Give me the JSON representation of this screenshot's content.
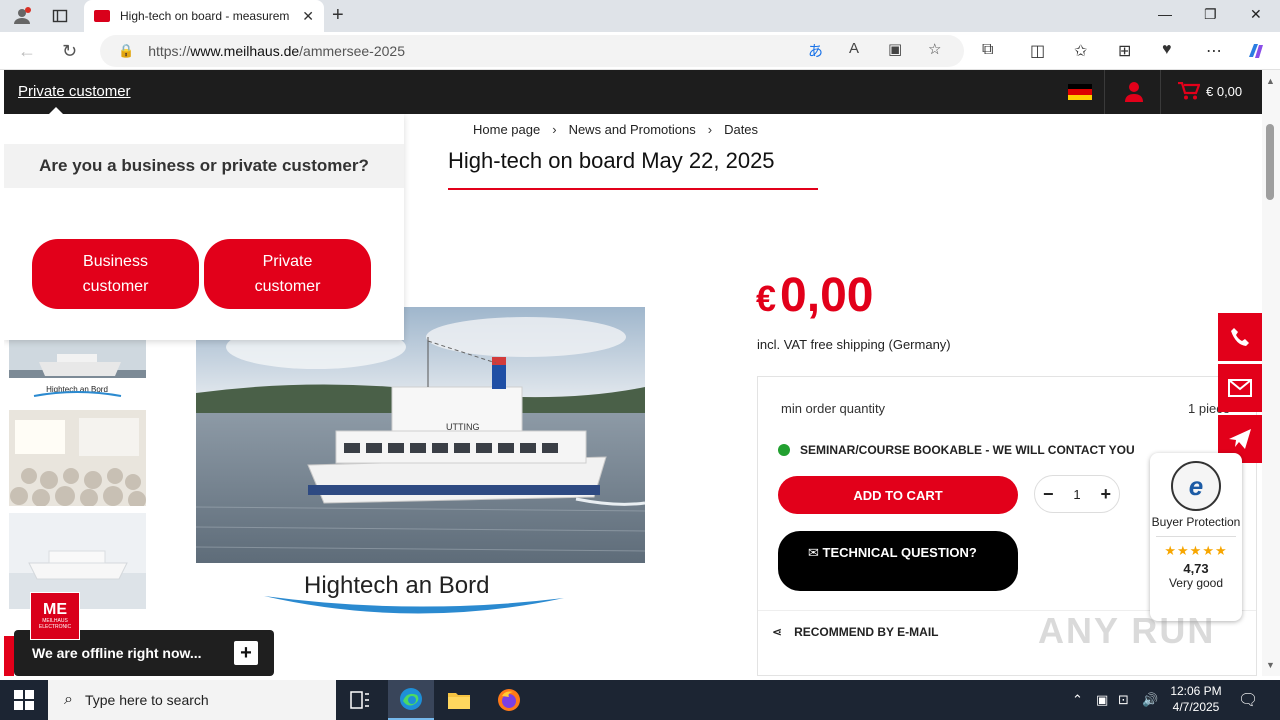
{
  "browser": {
    "tab_title": "High-tech on board - measurem",
    "url_scheme": "https://",
    "url_host": "www.meilhaus.de",
    "url_path": "/ammersee-2025"
  },
  "header": {
    "customer_link": "Private customer",
    "cart_total": "€ 0,00"
  },
  "popup": {
    "question": "Are you a business or private customer?",
    "business_button": "Business customer",
    "private_button": "Private customer"
  },
  "breadcrumb": [
    "Home page",
    "News and Promotions",
    "Dates"
  ],
  "product": {
    "title": "High-tech on board May 22, 2025",
    "price_currency": "€",
    "price_value": "0,00",
    "vat_note": "incl. VAT free shipping (Germany)",
    "image_caption": "Hightech an Bord",
    "thumb_caption": "Hightech an Bord",
    "ship_name": "UTTING",
    "min_order_label": "min order quantity",
    "min_order_value": "1 piece",
    "status": "SEMINAR/COURSE BOOKABLE - WE WILL CONTACT YOU",
    "add_to_cart": "ADD TO CART",
    "quantity": "1",
    "technical_question": "TECHNICAL QUESTION?",
    "recommend": "RECOMMEND BY E-MAIL"
  },
  "trust_badge": {
    "label": "Buyer Protection",
    "score": "4,73",
    "rating_text": "Very good",
    "stars": "★★★★★"
  },
  "chat": {
    "offline_message": "We are offline right now...",
    "logo_text": "MEILHAUS ELECTRONIC"
  },
  "watermark": "ANY RUN",
  "taskbar": {
    "search_placeholder": "Type here to search",
    "time": "12:06 PM",
    "date": "4/7/2025"
  },
  "colors": {
    "brand_red": "#e2001a",
    "header_dark": "#1d1d1d",
    "status_green": "#22a030",
    "star_gold": "#f7a600"
  }
}
